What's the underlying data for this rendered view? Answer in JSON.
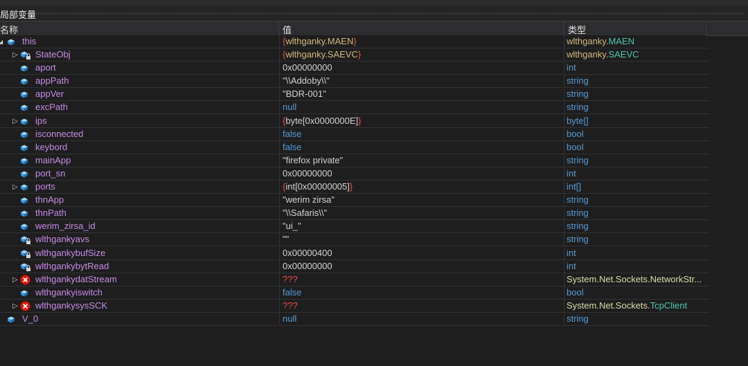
{
  "panel": {
    "title": "局部变量"
  },
  "columns": {
    "name": "名称",
    "value": "值",
    "type": "类型"
  },
  "rows": [
    {
      "name": "this",
      "value": "{wlthganky.MAEN}",
      "type": "wlthganky.MAEN",
      "level": 0,
      "expander": "open",
      "icon": "field",
      "vkind": "object",
      "tkind": "class"
    },
    {
      "name": "StateObj",
      "value": "{wlthganky.SAEVC}",
      "type": "wlthganky.SAEVC",
      "level": 1,
      "expander": "closed",
      "icon": "field-private",
      "vkind": "object",
      "tkind": "class"
    },
    {
      "name": "aport",
      "value": "0x00000000",
      "type": "int",
      "level": 1,
      "expander": "",
      "icon": "field",
      "vkind": "num",
      "tkind": "kw"
    },
    {
      "name": "appPath",
      "value": "\"\\\\Addoby\\\\\"",
      "type": "string",
      "level": 1,
      "expander": "",
      "icon": "field",
      "vkind": "str",
      "tkind": "kw"
    },
    {
      "name": "appVer",
      "value": "\"BDR-001\"",
      "type": "string",
      "level": 1,
      "expander": "",
      "icon": "field",
      "vkind": "str",
      "tkind": "kw"
    },
    {
      "name": "excPath",
      "value": "null",
      "type": "string",
      "level": 1,
      "expander": "",
      "icon": "field",
      "vkind": "kw",
      "tkind": "kw"
    },
    {
      "name": "ips",
      "value": "{byte[0x0000000E]}",
      "type": "byte[]",
      "level": 1,
      "expander": "closed",
      "icon": "field",
      "vkind": "array",
      "tkind": "kw"
    },
    {
      "name": "isconnected",
      "value": "false",
      "type": "bool",
      "level": 1,
      "expander": "",
      "icon": "field",
      "vkind": "kw",
      "tkind": "kw"
    },
    {
      "name": "keybord",
      "value": "false",
      "type": "bool",
      "level": 1,
      "expander": "",
      "icon": "field",
      "vkind": "kw",
      "tkind": "kw"
    },
    {
      "name": "mainApp",
      "value": "\"firefox private\"",
      "type": "string",
      "level": 1,
      "expander": "",
      "icon": "field",
      "vkind": "str",
      "tkind": "kw"
    },
    {
      "name": "port_sn",
      "value": "0x00000000",
      "type": "int",
      "level": 1,
      "expander": "",
      "icon": "field",
      "vkind": "num",
      "tkind": "kw"
    },
    {
      "name": "ports",
      "value": "{int[0x00000005]}",
      "type": "int[]",
      "level": 1,
      "expander": "closed",
      "icon": "field",
      "vkind": "array",
      "tkind": "kw"
    },
    {
      "name": "thnApp",
      "value": "\"werim zirsa\"",
      "type": "string",
      "level": 1,
      "expander": "",
      "icon": "field",
      "vkind": "str",
      "tkind": "kw"
    },
    {
      "name": "thnPath",
      "value": "\"\\\\Safaris\\\\\"",
      "type": "string",
      "level": 1,
      "expander": "",
      "icon": "field",
      "vkind": "str",
      "tkind": "kw"
    },
    {
      "name": "werim_zirsa_id",
      "value": "\"ui_\"",
      "type": "string",
      "level": 1,
      "expander": "",
      "icon": "field",
      "vkind": "str",
      "tkind": "kw"
    },
    {
      "name": "wlthgankyavs",
      "value": "\"\"",
      "type": "string",
      "level": 1,
      "expander": "",
      "icon": "field-private",
      "vkind": "str",
      "tkind": "kw"
    },
    {
      "name": "wlthgankybufSize",
      "value": "0x00000400",
      "type": "int",
      "level": 1,
      "expander": "",
      "icon": "field-private",
      "vkind": "num",
      "tkind": "kw"
    },
    {
      "name": "wlthgankybytRead",
      "value": "0x00000000",
      "type": "int",
      "level": 1,
      "expander": "",
      "icon": "field-private",
      "vkind": "num",
      "tkind": "kw"
    },
    {
      "name": "wlthgankydatStream",
      "value": "???",
      "type": "System.Net.Sockets.NetworkStr...",
      "level": 1,
      "expander": "closed",
      "icon": "error",
      "vkind": "err",
      "tkind": "sys"
    },
    {
      "name": "wlthgankyiswitch",
      "value": "false",
      "type": "bool",
      "level": 1,
      "expander": "",
      "icon": "field",
      "vkind": "kw",
      "tkind": "kw"
    },
    {
      "name": "wlthgankysysSCK",
      "value": "???",
      "type": "System.Net.Sockets.TcpClient",
      "level": 1,
      "expander": "closed",
      "icon": "error",
      "vkind": "err",
      "tkind": "sys"
    },
    {
      "name": "V_0",
      "value": "null",
      "type": "string",
      "level": 0,
      "expander": "",
      "icon": "field",
      "vkind": "kw",
      "tkind": "kw"
    }
  ],
  "colors": {
    "background": "#1e1e1e",
    "name": "#c88de6",
    "keyword": "#569cd6",
    "error": "#f14c4c",
    "class": "#4ec9b0",
    "brace": "#f14c4c"
  }
}
